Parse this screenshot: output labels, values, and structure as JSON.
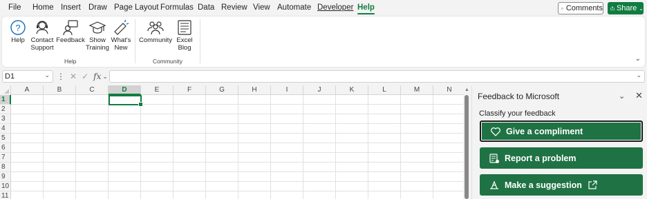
{
  "menu": {
    "tabs": [
      "File",
      "Home",
      "Insert",
      "Draw",
      "Page Layout",
      "Formulas",
      "Data",
      "Review",
      "View",
      "Automate",
      "Developer",
      "Help"
    ],
    "active": "Help",
    "comments_label": "Comments",
    "share_label": "Share"
  },
  "ribbon": {
    "help_group": {
      "label": "Help",
      "buttons": [
        {
          "line1": "Help",
          "line2": "",
          "icon": "help-icon"
        },
        {
          "line1": "Contact",
          "line2": "Support",
          "icon": "headset-icon"
        },
        {
          "line1": "Feedback",
          "line2": "",
          "icon": "feedback-icon"
        },
        {
          "line1": "Show",
          "line2": "Training",
          "icon": "mortarboard-icon"
        },
        {
          "line1": "What's",
          "line2": "New",
          "icon": "megaphone-icon"
        }
      ]
    },
    "community_group": {
      "label": "Community",
      "buttons": [
        {
          "line1": "Community",
          "line2": "",
          "icon": "people-icon"
        },
        {
          "line1": "Excel",
          "line2": "Blog",
          "icon": "news-icon"
        }
      ]
    }
  },
  "formula_bar": {
    "name_box": "D1",
    "fx": "fx",
    "formula": ""
  },
  "grid": {
    "columns": [
      "A",
      "B",
      "C",
      "D",
      "E",
      "F",
      "G",
      "H",
      "I",
      "J",
      "K",
      "L",
      "M",
      "N"
    ],
    "rows": [
      "1",
      "2",
      "3",
      "4",
      "5",
      "6",
      "7",
      "8",
      "9",
      "10",
      "11"
    ],
    "selected_column": "D",
    "selected_row": "1"
  },
  "feedback_pane": {
    "title": "Feedback to Microsoft",
    "subtitle": "Classify your feedback",
    "buttons": [
      {
        "label": "Give a compliment",
        "icon": "heart-icon"
      },
      {
        "label": "Report a problem",
        "icon": "report-icon"
      },
      {
        "label": "Make a suggestion",
        "icon": "lightbulb-icon"
      }
    ],
    "accent": "#1f7244"
  },
  "colors": {
    "brand": "#107c41"
  }
}
